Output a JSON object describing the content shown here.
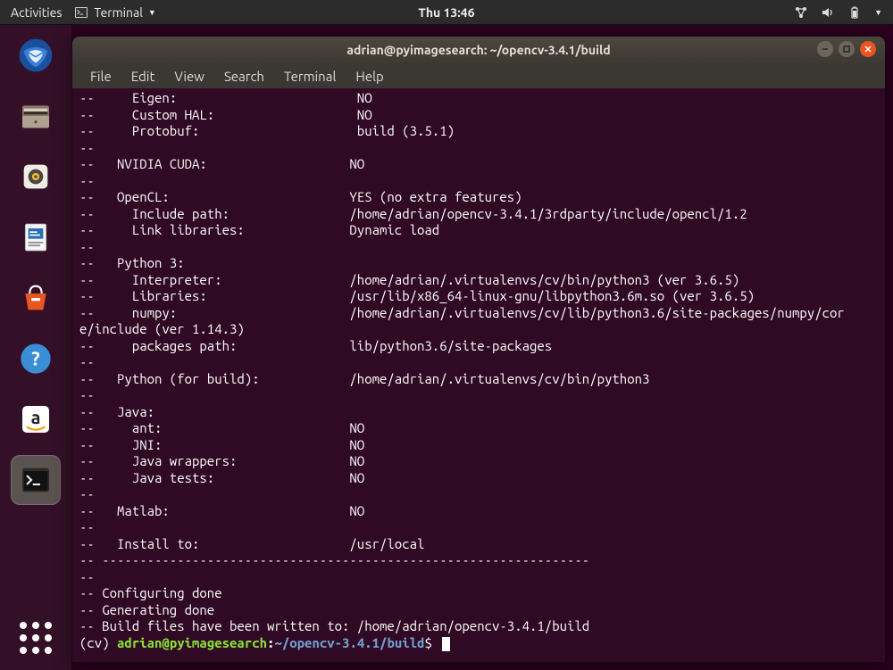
{
  "topbar": {
    "activities": "Activities",
    "app_label": "Terminal",
    "clock": "Thu 13:46"
  },
  "launcher": {
    "items": [
      {
        "name": "thunderbird-icon"
      },
      {
        "name": "files-icon"
      },
      {
        "name": "rhythmbox-icon"
      },
      {
        "name": "libreoffice-writer-icon"
      },
      {
        "name": "software-center-icon"
      },
      {
        "name": "help-icon"
      },
      {
        "name": "amazon-icon"
      },
      {
        "name": "terminal-icon"
      }
    ]
  },
  "window": {
    "title": "adrian@pyimagesearch: ~/opencv-3.4.1/build",
    "menu": [
      "File",
      "Edit",
      "View",
      "Search",
      "Terminal",
      "Help"
    ]
  },
  "terminal": {
    "lines": [
      "--     Eigen:                        NO",
      "--     Custom HAL:                   NO",
      "--     Protobuf:                     build (3.5.1)",
      "-- ",
      "--   NVIDIA CUDA:                   NO",
      "-- ",
      "--   OpenCL:                        YES (no extra features)",
      "--     Include path:                /home/adrian/opencv-3.4.1/3rdparty/include/opencl/1.2",
      "--     Link libraries:              Dynamic load",
      "-- ",
      "--   Python 3:",
      "--     Interpreter:                 /home/adrian/.virtualenvs/cv/bin/python3 (ver 3.6.5)",
      "--     Libraries:                   /usr/lib/x86_64-linux-gnu/libpython3.6m.so (ver 3.6.5)",
      "--     numpy:                       /home/adrian/.virtualenvs/cv/lib/python3.6/site-packages/numpy/cor",
      "e/include (ver 1.14.3)",
      "--     packages path:               lib/python3.6/site-packages",
      "-- ",
      "--   Python (for build):            /home/adrian/.virtualenvs/cv/bin/python3",
      "-- ",
      "--   Java:",
      "--     ant:                         NO",
      "--     JNI:                         NO",
      "--     Java wrappers:               NO",
      "--     Java tests:                  NO",
      "-- ",
      "--   Matlab:                        NO",
      "-- ",
      "--   Install to:                    /usr/local",
      "-- -----------------------------------------------------------------",
      "-- ",
      "-- Configuring done",
      "-- Generating done",
      "-- Build files have been written to: /home/adrian/opencv-3.4.1/build"
    ],
    "prompt": {
      "env": "(cv) ",
      "user": "adrian@pyimagesearch",
      "sep": ":",
      "path": "~/opencv-3.4.1/build",
      "dollar": "$ "
    }
  }
}
